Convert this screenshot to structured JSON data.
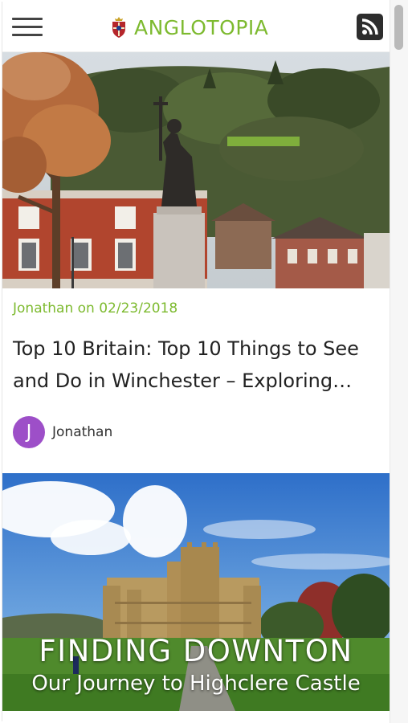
{
  "header": {
    "brand": "ANGLOTOPIA",
    "menu_icon": "hamburger-menu-icon",
    "rss_icon": "rss-feed-icon",
    "crest_icon": "crest-logo-icon",
    "brand_color": "#7dba2f"
  },
  "posts": [
    {
      "meta": "Jonathan on 02/23/2018",
      "title": "Top 10 Britain: Top 10 Things to See and Do in Winchester – Exploring…",
      "author_initial": "J",
      "author_name": "Jonathan",
      "avatar_color": "#9d4fc8",
      "image_alt": "Statue in Winchester with autumn trees and hillside"
    },
    {
      "overlay_line1": "FINDING DOWNTON",
      "overlay_line2": "Our Journey to Highclere Castle",
      "image_alt": "Highclere Castle under blue sky"
    }
  ]
}
